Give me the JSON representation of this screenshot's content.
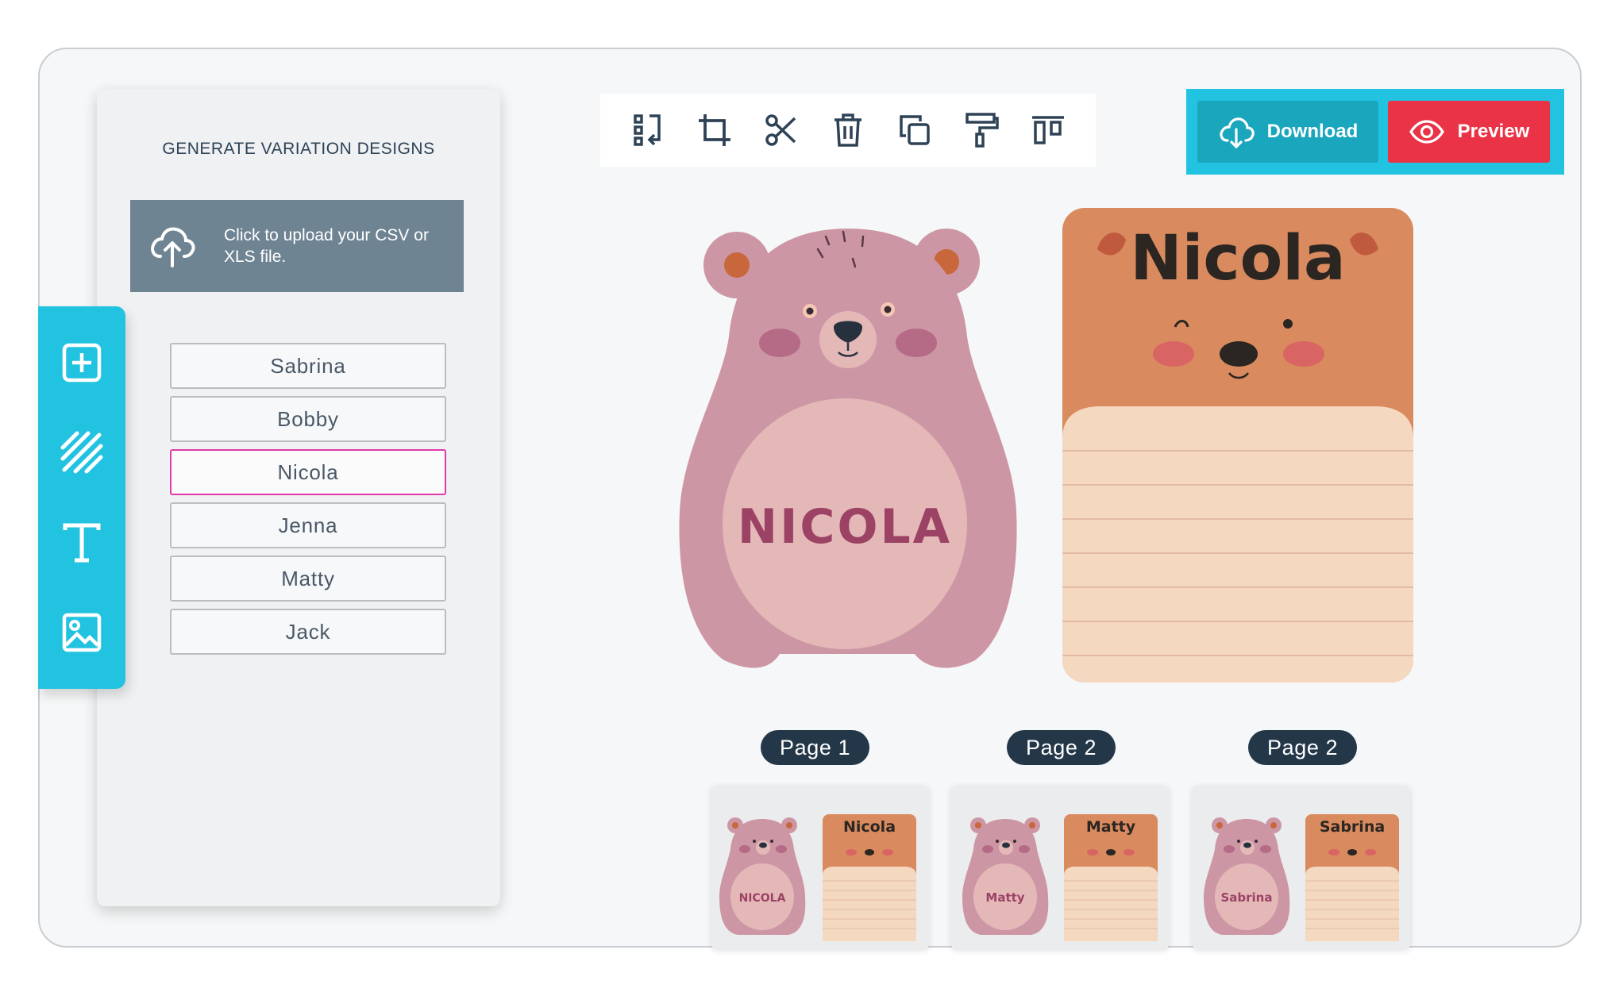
{
  "panel": {
    "title": "GENERATE VARIATION DESIGNS",
    "upload_text": "Click to upload your CSV or XLS file.",
    "names": [
      "Sabrina",
      "Bobby",
      "Nicola",
      "Jenna",
      "Matty",
      "Jack"
    ],
    "selected_name": "Nicola"
  },
  "tools": [
    "add-element-icon",
    "pattern-icon",
    "text-icon",
    "image-icon"
  ],
  "toolbar": [
    "swap-icon",
    "crop-icon",
    "scissors-icon",
    "trash-icon",
    "duplicate-icon",
    "format-painter-icon",
    "align-icon"
  ],
  "actions": {
    "download_label": "Download",
    "preview_label": "Preview"
  },
  "canvas": {
    "bear_name": "NICOLA",
    "note_name": "Nicola"
  },
  "pages": [
    {
      "label": "Page 1",
      "bear_name": "NICOLA",
      "note_name": "Nicola"
    },
    {
      "label": "Page 2",
      "bear_name": "Matty",
      "note_name": "Matty"
    },
    {
      "label": "Page 2",
      "bear_name": "Sabrina",
      "note_name": "Sabrina"
    }
  ],
  "colors": {
    "accent": "#22c3e0",
    "download": "#1aa6bd",
    "preview": "#ea3347",
    "bear": "#cd96a4",
    "belly": "#e5b8b8",
    "note_top": "#d98a5e",
    "note_paper": "#f5d8c0",
    "selected_border": "#e03aa8",
    "page_label": "#233749"
  }
}
